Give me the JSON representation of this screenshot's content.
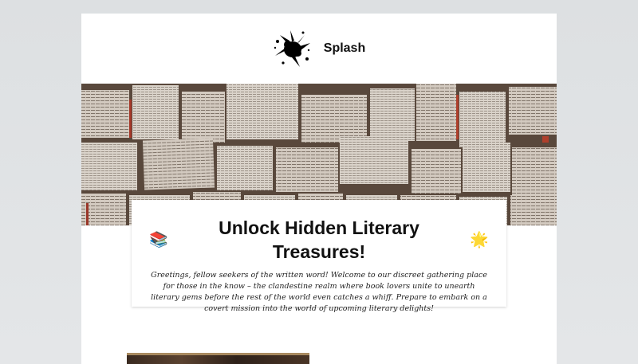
{
  "header": {
    "brand": "Splash",
    "logo_icon": "ink-splash-icon"
  },
  "hero": {
    "image": "open-books-collage-image"
  },
  "intro": {
    "title_emoji_left": "📚",
    "title": "Unlock Hidden Literary Treasures!",
    "title_emoji_right": "🌟",
    "body": "Greetings, fellow seekers of the written word! Welcome to our discreet gathering place for those in the know – the clandestine realm where book lovers unite to unearth literary gems before the rest of the world even catches a whiff. Prepare to embark on a covert mission into the world of upcoming literary delights!"
  },
  "colors": {
    "page_background": "#dde0e2",
    "card_background": "#ffffff",
    "text": "#111111"
  }
}
